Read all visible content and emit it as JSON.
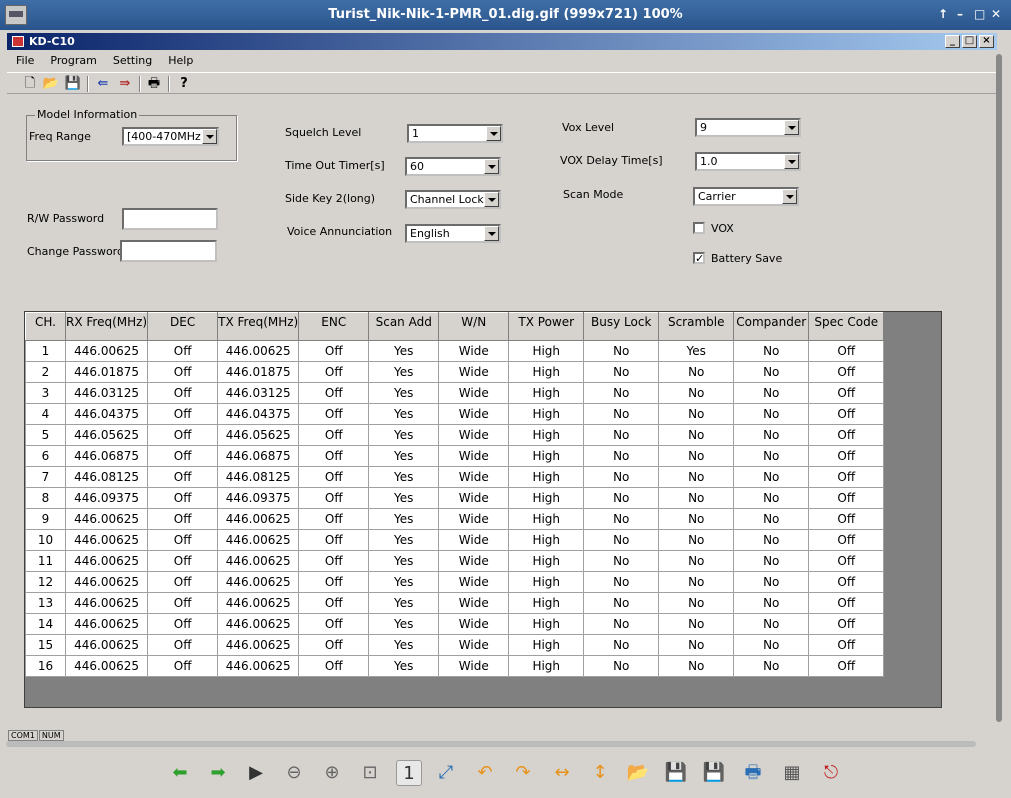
{
  "viewer": {
    "title": "Turist_Nik-Nik-1-PMR_01.dig.gif (999x721) 100%",
    "controls": [
      "↑",
      "–",
      "□",
      "✕"
    ]
  },
  "app": {
    "title": "KD-C10",
    "window_buttons": [
      "_",
      "□",
      "×"
    ]
  },
  "menu": {
    "file": "File",
    "program": "Program",
    "setting": "Setting",
    "help": "Help"
  },
  "toolbar_icons": [
    "new-file-icon",
    "open-folder-icon",
    "save-icon",
    "read-radio-icon",
    "write-radio-icon",
    "print-icon",
    "help-icon"
  ],
  "settings": {
    "model_info_legend": "Model Information",
    "freq_range_label": "Freq Range",
    "freq_range_value": "[400-470MHz]",
    "rw_password_label": "R/W Password",
    "rw_password_value": "",
    "change_password_label": "Change Password",
    "change_password_value": "",
    "squelch_label": "Squelch Level",
    "squelch_value": "1",
    "tot_label": "Time Out Timer[s]",
    "tot_value": "60",
    "sidekey_label": "Side Key 2(long)",
    "sidekey_value": "Channel Lock",
    "voice_label": "Voice Annunciation",
    "voice_value": "English",
    "vox_level_label": "Vox Level",
    "vox_level_value": "9",
    "vox_delay_label": "VOX Delay Time[s]",
    "vox_delay_value": "1.0",
    "scan_mode_label": "Scan Mode",
    "scan_mode_value": "Carrier",
    "vox_check_label": "VOX",
    "vox_checked": false,
    "battery_save_label": "Battery Save",
    "battery_save_checked": true
  },
  "grid": {
    "headers": [
      "CH.",
      "RX Freq(MHz)",
      "DEC",
      "TX Freq(MHz)",
      "ENC",
      "Scan Add",
      "W/N",
      "TX Power",
      "Busy Lock",
      "Scramble",
      "Compander",
      "Spec Code"
    ],
    "rows": [
      [
        "1",
        "446.00625",
        "Off",
        "446.00625",
        "Off",
        "Yes",
        "Wide",
        "High",
        "No",
        "Yes",
        "No",
        "Off"
      ],
      [
        "2",
        "446.01875",
        "Off",
        "446.01875",
        "Off",
        "Yes",
        "Wide",
        "High",
        "No",
        "No",
        "No",
        "Off"
      ],
      [
        "3",
        "446.03125",
        "Off",
        "446.03125",
        "Off",
        "Yes",
        "Wide",
        "High",
        "No",
        "No",
        "No",
        "Off"
      ],
      [
        "4",
        "446.04375",
        "Off",
        "446.04375",
        "Off",
        "Yes",
        "Wide",
        "High",
        "No",
        "No",
        "No",
        "Off"
      ],
      [
        "5",
        "446.05625",
        "Off",
        "446.05625",
        "Off",
        "Yes",
        "Wide",
        "High",
        "No",
        "No",
        "No",
        "Off"
      ],
      [
        "6",
        "446.06875",
        "Off",
        "446.06875",
        "Off",
        "Yes",
        "Wide",
        "High",
        "No",
        "No",
        "No",
        "Off"
      ],
      [
        "7",
        "446.08125",
        "Off",
        "446.08125",
        "Off",
        "Yes",
        "Wide",
        "High",
        "No",
        "No",
        "No",
        "Off"
      ],
      [
        "8",
        "446.09375",
        "Off",
        "446.09375",
        "Off",
        "Yes",
        "Wide",
        "High",
        "No",
        "No",
        "No",
        "Off"
      ],
      [
        "9",
        "446.00625",
        "Off",
        "446.00625",
        "Off",
        "Yes",
        "Wide",
        "High",
        "No",
        "No",
        "No",
        "Off"
      ],
      [
        "10",
        "446.00625",
        "Off",
        "446.00625",
        "Off",
        "Yes",
        "Wide",
        "High",
        "No",
        "No",
        "No",
        "Off"
      ],
      [
        "11",
        "446.00625",
        "Off",
        "446.00625",
        "Off",
        "Yes",
        "Wide",
        "High",
        "No",
        "No",
        "No",
        "Off"
      ],
      [
        "12",
        "446.00625",
        "Off",
        "446.00625",
        "Off",
        "Yes",
        "Wide",
        "High",
        "No",
        "No",
        "No",
        "Off"
      ],
      [
        "13",
        "446.00625",
        "Off",
        "446.00625",
        "Off",
        "Yes",
        "Wide",
        "High",
        "No",
        "No",
        "No",
        "Off"
      ],
      [
        "14",
        "446.00625",
        "Off",
        "446.00625",
        "Off",
        "Yes",
        "Wide",
        "High",
        "No",
        "No",
        "No",
        "Off"
      ],
      [
        "15",
        "446.00625",
        "Off",
        "446.00625",
        "Off",
        "Yes",
        "Wide",
        "High",
        "No",
        "No",
        "No",
        "Off"
      ],
      [
        "16",
        "446.00625",
        "Off",
        "446.00625",
        "Off",
        "Yes",
        "Wide",
        "High",
        "No",
        "No",
        "No",
        "Off"
      ]
    ]
  },
  "status": {
    "port": "COM1",
    "num": "NUM"
  },
  "viewer_toolbar": {
    "buttons": [
      {
        "name": "previous-image-icon",
        "glyph": "⬅",
        "color": "#2ea02e"
      },
      {
        "name": "next-image-icon",
        "glyph": "➡",
        "color": "#2ea02e"
      },
      {
        "name": "slideshow-play-icon",
        "glyph": "▶",
        "color": "#333333"
      },
      {
        "name": "zoom-out-icon",
        "glyph": "⊖",
        "color": "#666666"
      },
      {
        "name": "zoom-in-icon",
        "glyph": "⊕",
        "color": "#666666"
      },
      {
        "name": "zoom-fit-icon",
        "glyph": "⊡",
        "color": "#666666"
      },
      {
        "name": "zoom-original-icon",
        "glyph": "1",
        "color": "#333333"
      },
      {
        "name": "fullscreen-icon",
        "glyph": "⤢",
        "color": "#2a6fb5"
      },
      {
        "name": "rotate-left-icon",
        "glyph": "↶",
        "color": "#e8921a"
      },
      {
        "name": "rotate-right-icon",
        "glyph": "↷",
        "color": "#e8921a"
      },
      {
        "name": "flip-horizontal-icon",
        "glyph": "↔",
        "color": "#e8921a"
      },
      {
        "name": "flip-vertical-icon",
        "glyph": "↕",
        "color": "#e8921a"
      },
      {
        "name": "open-file-icon",
        "glyph": "📂",
        "color": "#2a6fb5"
      },
      {
        "name": "save-image-icon",
        "glyph": "💾",
        "color": "#2a6fb5"
      },
      {
        "name": "save-as-icon",
        "glyph": "💾",
        "color": "#2a6fb5"
      },
      {
        "name": "print-image-icon",
        "glyph": "🖶",
        "color": "#2a6fb5"
      },
      {
        "name": "properties-icon",
        "glyph": "▦",
        "color": "#555555"
      },
      {
        "name": "exit-viewer-icon",
        "glyph": "⎋",
        "color": "#c02020"
      }
    ],
    "active_index": 6
  }
}
